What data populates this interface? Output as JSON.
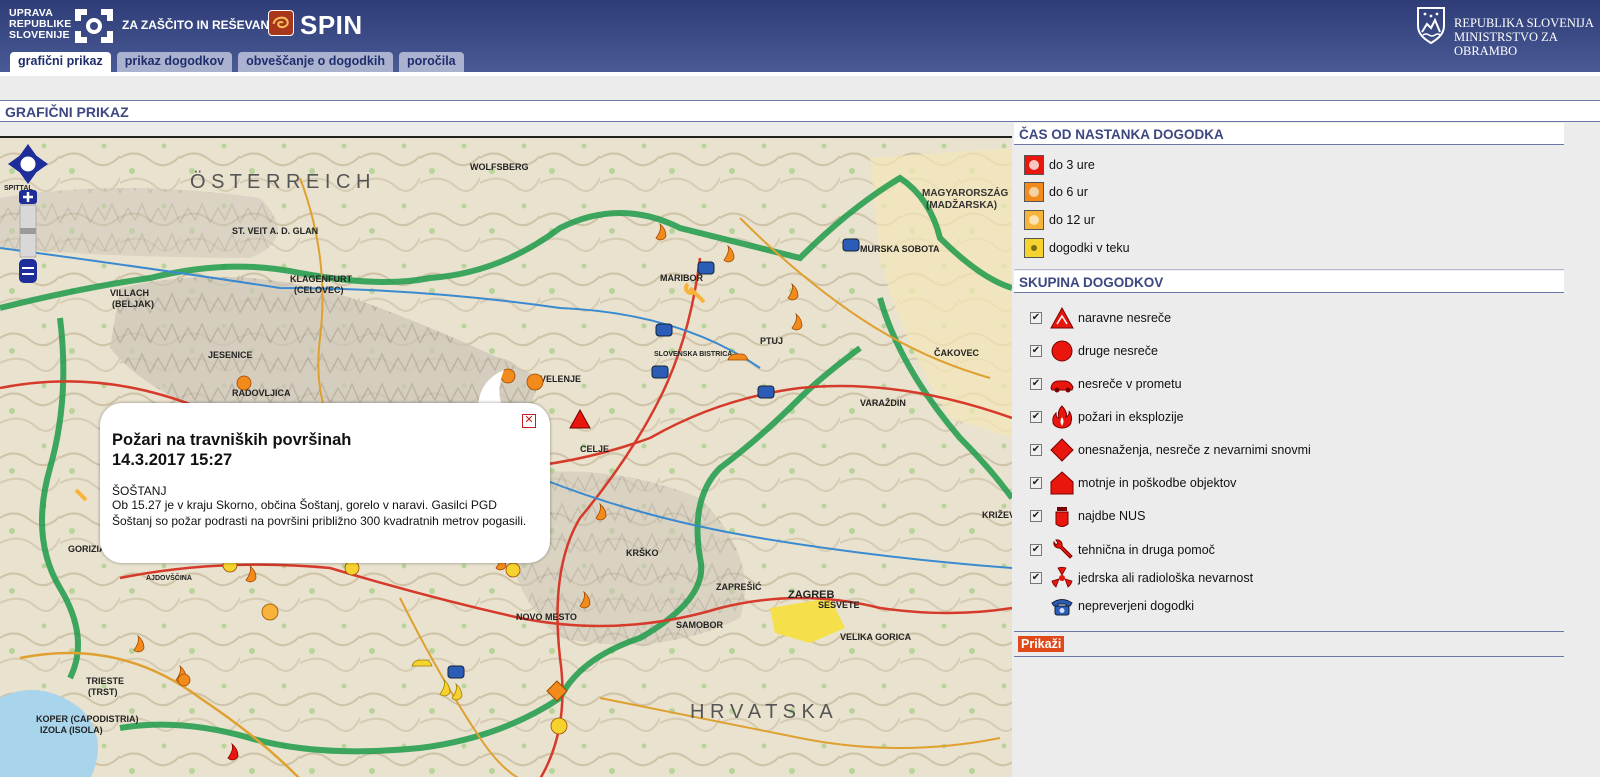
{
  "header": {
    "urs_line1": "UPRAVA",
    "urs_line2": "REPUBLIKE",
    "urs_line3": "SLOVENIJE",
    "zr_text": "ZA ZAŠČITO IN REŠEVANJE",
    "spin": "SPIN",
    "rs_line1": "REPUBLIKA SLOVENIJA",
    "rs_line2": "MINISTRSTVO ZA OBRAMBO",
    "logo_color": "#a8361c"
  },
  "tabs": [
    {
      "label": "grafični prikaz",
      "active": true
    },
    {
      "label": "prikaz dogodkov",
      "active": false
    },
    {
      "label": "obveščanje o dogodkih",
      "active": false
    },
    {
      "label": "poročila",
      "active": false
    }
  ],
  "section_title": "GRAFIČNI PRIKAZ",
  "map": {
    "labels": {
      "wolfsberg": "WOLFSBERG",
      "stveit": "ST. VEIT A. D. GLAN",
      "klagenfurt": "KLAGENFURT",
      "celovec": "(CELOVEC)",
      "villach": "VILLACH",
      "beljak": "(BELJAK)",
      "maribor": "MARIBOR",
      "murska": "MURSKA SOBOTA",
      "ptuj": "PTUJ",
      "celje": "CELJE",
      "velenje": "VELENJE",
      "jesenice": "JESENICE",
      "radovljica": "RADOVLJICA",
      "varazdin": "VARAŽDIN",
      "cakovec": "ČAKOVEC",
      "krizevci": "KRIŽEVCI",
      "zagreb": "ZAGREB",
      "sesvete": "SESVETE",
      "samobor": "SAMOBOR",
      "zapresic": "ZAPREŠIĆ",
      "novomesto": "NOVO MESTO",
      "krsko": "KRŠKO",
      "trieste": "TRIESTE",
      "trst": "(TRST)",
      "koper": "KOPER (CAPODISTRIA)",
      "izola": "IZOLA (ISOLA)",
      "gorizia": "GORIZIA",
      "velikagorica": "VELIKA GORICA",
      "magyarorszag": "MAGYARORSZÁG",
      "madzarska": "(MADŽARSKA)",
      "osterreich": "Ö S T E R R E I C H",
      "hrvatska": "H R V A T S K A",
      "slovenskabistrica": "SLOVENSKA BISTRICA",
      "ajdovscina": "AJDOVŠČINA",
      "spittal": "SPITTAL"
    },
    "popup": {
      "title_line1": "Požari na travniških površinah",
      "title_line2": "14.3.2017 15:27",
      "location": "ŠOŠTANJ",
      "description": "Ob 15.27 je v kraju Skorno, občina Šoštanj, gorelo v naravi. Gasilci PGD Šoštanj so požar podrasti na površini približno 300 kvadratnih metrov pogasili."
    }
  },
  "legend_time": {
    "title": "ČAS OD NASTANKA DOGODKA",
    "items": [
      {
        "label": "do 3 ure",
        "color": "#e8160c"
      },
      {
        "label": "do 6 ur",
        "color": "#f28a1c"
      },
      {
        "label": "do 12 ur",
        "color": "#f6b43a"
      },
      {
        "label": "dogodki v teku",
        "color": "#f5d22e"
      }
    ]
  },
  "legend_groups": {
    "title": "SKUPINA DOGODKOV",
    "items": [
      {
        "label": "naravne nesreče",
        "icon": "natural-disaster-icon",
        "checked": true
      },
      {
        "label": "druge nesreče",
        "icon": "other-accident-icon",
        "checked": true
      },
      {
        "label": "nesreče v prometu",
        "icon": "traffic-accident-icon",
        "checked": true
      },
      {
        "label": "požari in eksplozije",
        "icon": "fire-icon",
        "checked": true
      },
      {
        "label": "onesnaženja, nesreče z nevarnimi snovmi",
        "icon": "hazmat-icon",
        "checked": true
      },
      {
        "label": "motnje in poškodbe objektov",
        "icon": "building-damage-icon",
        "checked": true
      },
      {
        "label": "najdbe NUS",
        "icon": "ordnance-icon",
        "checked": true
      },
      {
        "label": "tehnična in druga pomoč",
        "icon": "wrench-icon",
        "checked": true
      },
      {
        "label": "jedrska ali radiološka nevarnost",
        "icon": "radiation-icon",
        "checked": true
      },
      {
        "label": "nepreverjeni dogodki",
        "icon": "phone-icon",
        "checked": false
      }
    ],
    "check_mark": "✔"
  },
  "show_button": "Prikaži",
  "popup_close": "✕"
}
